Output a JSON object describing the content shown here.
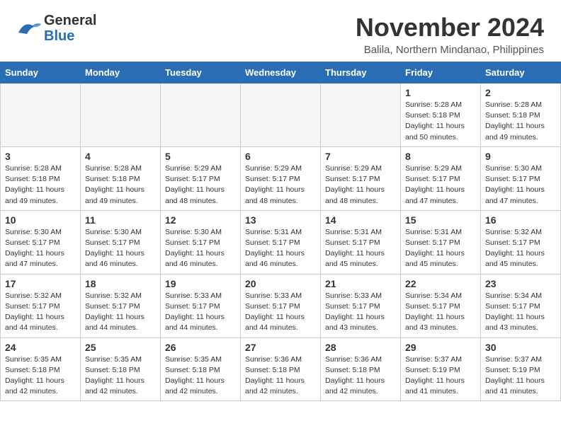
{
  "header": {
    "logo_general": "General",
    "logo_blue": "Blue",
    "month_year": "November 2024",
    "location": "Balila, Northern Mindanao, Philippines"
  },
  "weekdays": [
    "Sunday",
    "Monday",
    "Tuesday",
    "Wednesday",
    "Thursday",
    "Friday",
    "Saturday"
  ],
  "weeks": [
    [
      {
        "day": "",
        "info": ""
      },
      {
        "day": "",
        "info": ""
      },
      {
        "day": "",
        "info": ""
      },
      {
        "day": "",
        "info": ""
      },
      {
        "day": "",
        "info": ""
      },
      {
        "day": "1",
        "info": "Sunrise: 5:28 AM\nSunset: 5:18 PM\nDaylight: 11 hours\nand 50 minutes."
      },
      {
        "day": "2",
        "info": "Sunrise: 5:28 AM\nSunset: 5:18 PM\nDaylight: 11 hours\nand 49 minutes."
      }
    ],
    [
      {
        "day": "3",
        "info": "Sunrise: 5:28 AM\nSunset: 5:18 PM\nDaylight: 11 hours\nand 49 minutes."
      },
      {
        "day": "4",
        "info": "Sunrise: 5:28 AM\nSunset: 5:18 PM\nDaylight: 11 hours\nand 49 minutes."
      },
      {
        "day": "5",
        "info": "Sunrise: 5:29 AM\nSunset: 5:17 PM\nDaylight: 11 hours\nand 48 minutes."
      },
      {
        "day": "6",
        "info": "Sunrise: 5:29 AM\nSunset: 5:17 PM\nDaylight: 11 hours\nand 48 minutes."
      },
      {
        "day": "7",
        "info": "Sunrise: 5:29 AM\nSunset: 5:17 PM\nDaylight: 11 hours\nand 48 minutes."
      },
      {
        "day": "8",
        "info": "Sunrise: 5:29 AM\nSunset: 5:17 PM\nDaylight: 11 hours\nand 47 minutes."
      },
      {
        "day": "9",
        "info": "Sunrise: 5:30 AM\nSunset: 5:17 PM\nDaylight: 11 hours\nand 47 minutes."
      }
    ],
    [
      {
        "day": "10",
        "info": "Sunrise: 5:30 AM\nSunset: 5:17 PM\nDaylight: 11 hours\nand 47 minutes."
      },
      {
        "day": "11",
        "info": "Sunrise: 5:30 AM\nSunset: 5:17 PM\nDaylight: 11 hours\nand 46 minutes."
      },
      {
        "day": "12",
        "info": "Sunrise: 5:30 AM\nSunset: 5:17 PM\nDaylight: 11 hours\nand 46 minutes."
      },
      {
        "day": "13",
        "info": "Sunrise: 5:31 AM\nSunset: 5:17 PM\nDaylight: 11 hours\nand 46 minutes."
      },
      {
        "day": "14",
        "info": "Sunrise: 5:31 AM\nSunset: 5:17 PM\nDaylight: 11 hours\nand 45 minutes."
      },
      {
        "day": "15",
        "info": "Sunrise: 5:31 AM\nSunset: 5:17 PM\nDaylight: 11 hours\nand 45 minutes."
      },
      {
        "day": "16",
        "info": "Sunrise: 5:32 AM\nSunset: 5:17 PM\nDaylight: 11 hours\nand 45 minutes."
      }
    ],
    [
      {
        "day": "17",
        "info": "Sunrise: 5:32 AM\nSunset: 5:17 PM\nDaylight: 11 hours\nand 44 minutes."
      },
      {
        "day": "18",
        "info": "Sunrise: 5:32 AM\nSunset: 5:17 PM\nDaylight: 11 hours\nand 44 minutes."
      },
      {
        "day": "19",
        "info": "Sunrise: 5:33 AM\nSunset: 5:17 PM\nDaylight: 11 hours\nand 44 minutes."
      },
      {
        "day": "20",
        "info": "Sunrise: 5:33 AM\nSunset: 5:17 PM\nDaylight: 11 hours\nand 44 minutes."
      },
      {
        "day": "21",
        "info": "Sunrise: 5:33 AM\nSunset: 5:17 PM\nDaylight: 11 hours\nand 43 minutes."
      },
      {
        "day": "22",
        "info": "Sunrise: 5:34 AM\nSunset: 5:17 PM\nDaylight: 11 hours\nand 43 minutes."
      },
      {
        "day": "23",
        "info": "Sunrise: 5:34 AM\nSunset: 5:17 PM\nDaylight: 11 hours\nand 43 minutes."
      }
    ],
    [
      {
        "day": "24",
        "info": "Sunrise: 5:35 AM\nSunset: 5:18 PM\nDaylight: 11 hours\nand 42 minutes."
      },
      {
        "day": "25",
        "info": "Sunrise: 5:35 AM\nSunset: 5:18 PM\nDaylight: 11 hours\nand 42 minutes."
      },
      {
        "day": "26",
        "info": "Sunrise: 5:35 AM\nSunset: 5:18 PM\nDaylight: 11 hours\nand 42 minutes."
      },
      {
        "day": "27",
        "info": "Sunrise: 5:36 AM\nSunset: 5:18 PM\nDaylight: 11 hours\nand 42 minutes."
      },
      {
        "day": "28",
        "info": "Sunrise: 5:36 AM\nSunset: 5:18 PM\nDaylight: 11 hours\nand 42 minutes."
      },
      {
        "day": "29",
        "info": "Sunrise: 5:37 AM\nSunset: 5:19 PM\nDaylight: 11 hours\nand 41 minutes."
      },
      {
        "day": "30",
        "info": "Sunrise: 5:37 AM\nSunset: 5:19 PM\nDaylight: 11 hours\nand 41 minutes."
      }
    ]
  ]
}
